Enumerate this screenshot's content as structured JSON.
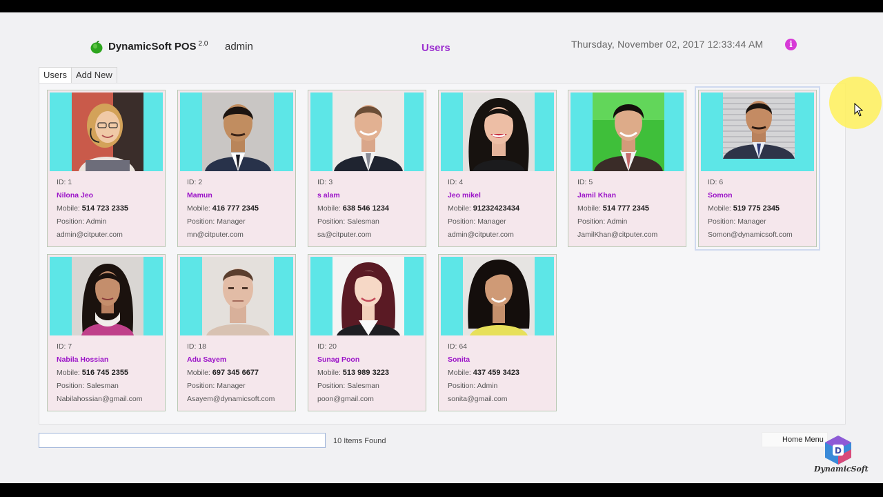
{
  "header": {
    "app_name": "DynamicSoft POS",
    "app_version": "2.0",
    "username": "admin",
    "page_title": "Users",
    "datetime": "Thursday,  November 02,  2017  12:33:44  AM",
    "info_icon": "info-icon",
    "info_glyph": "i"
  },
  "tabs": [
    {
      "label": "Users",
      "active": true
    },
    {
      "label": "Add New",
      "active": false
    }
  ],
  "labels": {
    "id_prefix": "ID: ",
    "mobile_prefix": "Mobile: ",
    "position_prefix": "Position: "
  },
  "users": [
    {
      "id": "1",
      "name": "Nilona Jeo",
      "mobile": "514 723 2335",
      "position": "Admin",
      "email": "admin@citputer.com"
    },
    {
      "id": "2",
      "name": "Mamun",
      "mobile": "416 777 2345",
      "position": "Manager",
      "email": "mn@citputer.com"
    },
    {
      "id": "3",
      "name": "s alam",
      "mobile": "638 546 1234",
      "position": "Salesman",
      "email": "sa@citputer.com"
    },
    {
      "id": "4",
      "name": "Jeo mikel",
      "mobile": "91232423434",
      "position": "Manager",
      "email": "admin@citputer.com"
    },
    {
      "id": "5",
      "name": "Jamil Khan",
      "mobile": "514 777 2345",
      "position": "Admin",
      "email": "JamilKhan@citputer.com"
    },
    {
      "id": "6",
      "name": "Somon",
      "mobile": "519 775 2345",
      "position": "Manager",
      "email": "Somon@dynamicsoft.com"
    },
    {
      "id": "7",
      "name": "Nabila Hossian",
      "mobile": "516 745 2355",
      "position": "Salesman",
      "email": "Nabilahossian@gmail.com"
    },
    {
      "id": "18",
      "name": "Adu Sayem",
      "mobile": "697 345 6677",
      "position": "Manager",
      "email": "Asayem@dynamicsoft.com"
    },
    {
      "id": "20",
      "name": "Sunag Poon",
      "mobile": "513 989 3223",
      "position": "Salesman",
      "email": "poon@gmail.com"
    },
    {
      "id": "64",
      "name": "Sonita",
      "mobile": "437 459 3423",
      "position": "Admin",
      "email": "sonita@gmail.com"
    }
  ],
  "footer": {
    "search_value": "",
    "items_found": "10 Items Found",
    "home_menu_label": "Home Menu",
    "brand_text": "DynamicSoft"
  },
  "colors": {
    "accent": "#9b2fcf",
    "photo_bg": "#5de6e7",
    "card_bg": "#f5e7ec",
    "name": "#9b12c8"
  }
}
